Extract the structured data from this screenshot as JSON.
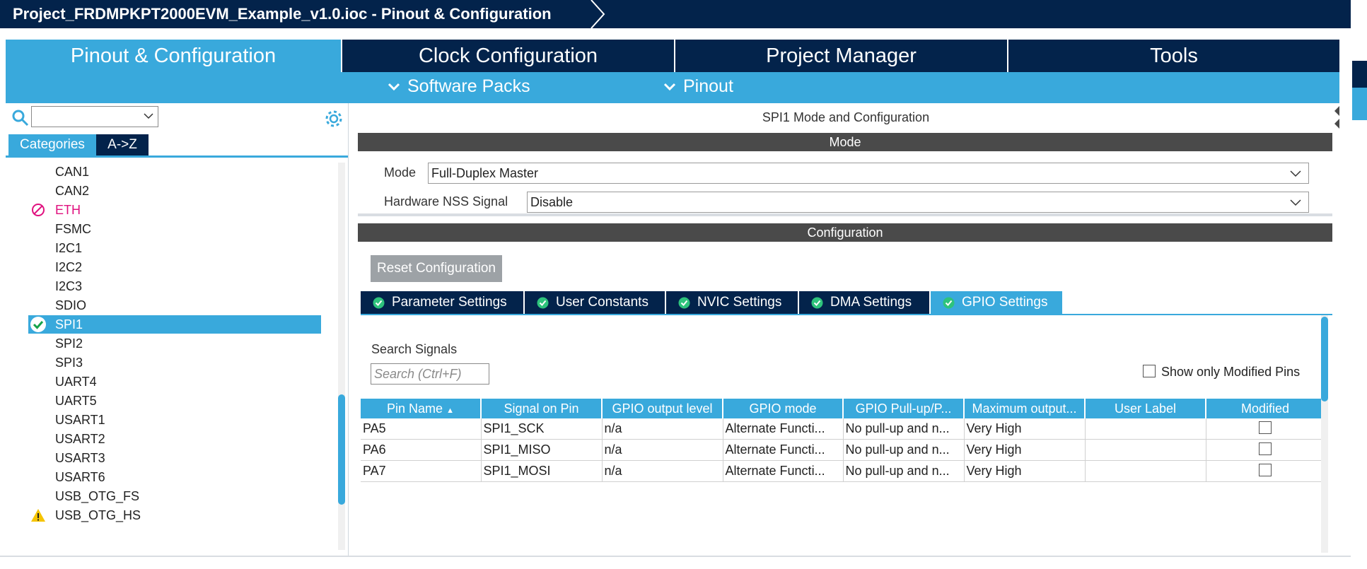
{
  "window": {
    "title": "Project_FRDMPKPT2000EVM_Example_v1.0.ioc - Pinout & Configuration"
  },
  "nav": {
    "tabs": [
      {
        "label": "Pinout & Configuration",
        "active": true
      },
      {
        "label": "Clock Configuration",
        "active": false
      },
      {
        "label": "Project Manager",
        "active": false
      },
      {
        "label": "Tools",
        "active": false
      }
    ],
    "sub": [
      {
        "label": "Software Packs"
      },
      {
        "label": "Pinout"
      }
    ]
  },
  "left": {
    "search_value": "",
    "tabs": [
      {
        "label": "Categories",
        "active": true
      },
      {
        "label": "A->Z",
        "active": false
      }
    ],
    "items": [
      {
        "label": "CAN1",
        "status": "none"
      },
      {
        "label": "CAN2",
        "status": "none"
      },
      {
        "label": "ETH",
        "status": "disabled"
      },
      {
        "label": "FSMC",
        "status": "none"
      },
      {
        "label": "I2C1",
        "status": "none"
      },
      {
        "label": "I2C2",
        "status": "none"
      },
      {
        "label": "I2C3",
        "status": "none"
      },
      {
        "label": "SDIO",
        "status": "none"
      },
      {
        "label": "SPI1",
        "status": "selected"
      },
      {
        "label": "SPI2",
        "status": "none"
      },
      {
        "label": "SPI3",
        "status": "none"
      },
      {
        "label": "UART4",
        "status": "none"
      },
      {
        "label": "UART5",
        "status": "none"
      },
      {
        "label": "USART1",
        "status": "none"
      },
      {
        "label": "USART2",
        "status": "none"
      },
      {
        "label": "USART3",
        "status": "none"
      },
      {
        "label": "USART6",
        "status": "none"
      },
      {
        "label": "USB_OTG_FS",
        "status": "none"
      },
      {
        "label": "USB_OTG_HS",
        "status": "warning"
      }
    ]
  },
  "right": {
    "heading": "SPI1 Mode and Configuration",
    "mode_section": "Mode",
    "mode_label": "Mode",
    "mode_value": "Full-Duplex Master",
    "nss_label": "Hardware NSS Signal",
    "nss_value": "Disable",
    "config_section": "Configuration",
    "reset_label": "Reset Configuration",
    "tabs": [
      {
        "label": "Parameter Settings",
        "active": false
      },
      {
        "label": "User Constants",
        "active": false
      },
      {
        "label": "NVIC Settings",
        "active": false
      },
      {
        "label": "DMA Settings",
        "active": false
      },
      {
        "label": "GPIO Settings",
        "active": true
      }
    ],
    "search_label": "Search Signals",
    "search_placeholder": "Search (Ctrl+F)",
    "show_modified_label": "Show only Modified Pins",
    "table": {
      "headers": [
        "Pin Name",
        "Signal on Pin",
        "GPIO output level",
        "GPIO mode",
        "GPIO Pull-up/P...",
        "Maximum output...",
        "User Label",
        "Modified"
      ],
      "rows": [
        [
          "PA5",
          "SPI1_SCK",
          "n/a",
          "Alternate Functi...",
          "No pull-up and n...",
          "Very High",
          "",
          ""
        ],
        [
          "PA6",
          "SPI1_MISO",
          "n/a",
          "Alternate Functi...",
          "No pull-up and n...",
          "Very High",
          "",
          ""
        ],
        [
          "PA7",
          "SPI1_MOSI",
          "n/a",
          "Alternate Functi...",
          "No pull-up and n...",
          "Very High",
          "",
          ""
        ]
      ]
    }
  },
  "colors": {
    "navy": "#03234b",
    "accent": "#39a9dc",
    "disabled": "#e0117f",
    "warning": "#f5c400",
    "ok": "#16a34a"
  }
}
